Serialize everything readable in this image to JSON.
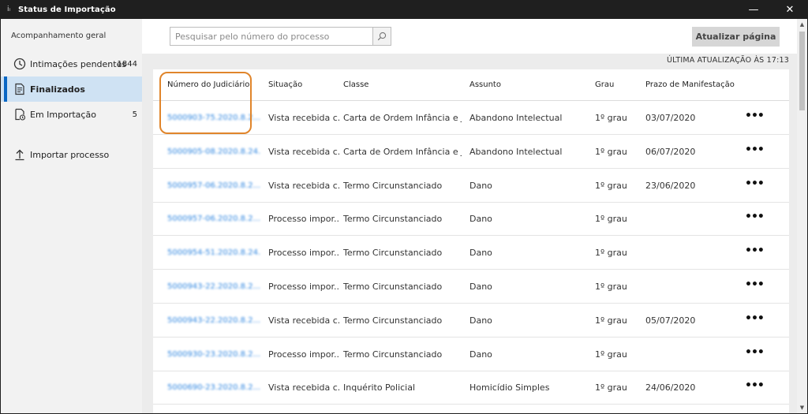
{
  "window": {
    "title": "Status de Importação",
    "app_icon_text": "iᵢ",
    "minimize_glyph": "—",
    "close_glyph": "✕"
  },
  "sidebar": {
    "heading": "Acompanhamento geral",
    "items": [
      {
        "label": "Intimações pendentes",
        "count": "1844",
        "icon": "clock-icon",
        "active": false
      },
      {
        "label": "Finalizados",
        "count": "",
        "icon": "document-list-icon",
        "active": true
      },
      {
        "label": "Em Importação",
        "count": "5",
        "icon": "document-sync-icon",
        "active": false
      }
    ],
    "import_label": "Importar processo"
  },
  "toolbar": {
    "search_placeholder": "Pesquisar pelo número do processo",
    "refresh_label": "Atualizar página",
    "last_update": "ÚLTIMA ATUALIZAÇÃO ÀS 17:13"
  },
  "table": {
    "columns": [
      "Número do Judiciário",
      "Situação",
      "Classe",
      "Assunto",
      "Grau",
      "Prazo de Manifestação"
    ],
    "rows": [
      {
        "numero": "5000903-75.2020.8.2...",
        "situacao": "Vista recebida c...",
        "classe": "Carta de Ordem Infância e J...",
        "assunto": "Abandono Intelectual",
        "grau": "1º grau",
        "prazo": "03/07/2020"
      },
      {
        "numero": "5000905-08.2020.8.24...",
        "situacao": "Vista recebida c...",
        "classe": "Carta de Ordem Infância e J...",
        "assunto": "Abandono Intelectual",
        "grau": "1º grau",
        "prazo": "06/07/2020"
      },
      {
        "numero": "5000957-06.2020.8.2...",
        "situacao": "Vista recebida c...",
        "classe": "Termo Circunstanciado",
        "assunto": "Dano",
        "grau": "1º grau",
        "prazo": "23/06/2020"
      },
      {
        "numero": "5000957-06.2020.8.2...",
        "situacao": "Processo impor...",
        "classe": "Termo Circunstanciado",
        "assunto": "Dano",
        "grau": "1º grau",
        "prazo": ""
      },
      {
        "numero": "5000954-51.2020.8.24...",
        "situacao": "Processo impor...",
        "classe": "Termo Circunstanciado",
        "assunto": "Dano",
        "grau": "1º grau",
        "prazo": ""
      },
      {
        "numero": "5000943-22.2020.8.2...",
        "situacao": "Processo impor...",
        "classe": "Termo Circunstanciado",
        "assunto": "Dano",
        "grau": "1º grau",
        "prazo": ""
      },
      {
        "numero": "5000943-22.2020.8.2...",
        "situacao": "Vista recebida c...",
        "classe": "Termo Circunstanciado",
        "assunto": "Dano",
        "grau": "1º grau",
        "prazo": "05/07/2020"
      },
      {
        "numero": "5000930-23.2020.8.2...",
        "situacao": "Processo impor...",
        "classe": "Termo Circunstanciado",
        "assunto": "Dano",
        "grau": "1º grau",
        "prazo": ""
      },
      {
        "numero": "5000690-23.2020.8.2...",
        "situacao": "Vista recebida c...",
        "classe": "Inquérito Policial",
        "assunto": "Homicídio Simples",
        "grau": "1º grau",
        "prazo": "24/06/2020"
      }
    ],
    "more_glyph": "•••"
  },
  "colors": {
    "accent": "#0a67c4",
    "active_bg": "#cfe2f3",
    "highlight": "#e0852b",
    "link": "#2f86e0"
  }
}
